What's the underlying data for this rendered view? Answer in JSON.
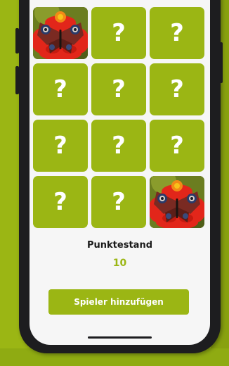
{
  "game": {
    "cards": [
      {
        "state": "revealed",
        "icon": "butterfly-on-flower-icon"
      },
      {
        "state": "hidden",
        "label": "?"
      },
      {
        "state": "hidden",
        "label": "?"
      },
      {
        "state": "hidden",
        "label": "?"
      },
      {
        "state": "hidden",
        "label": "?"
      },
      {
        "state": "hidden",
        "label": "?"
      },
      {
        "state": "hidden",
        "label": "?"
      },
      {
        "state": "hidden",
        "label": "?"
      },
      {
        "state": "hidden",
        "label": "?"
      },
      {
        "state": "hidden",
        "label": "?"
      },
      {
        "state": "hidden",
        "label": "?"
      },
      {
        "state": "revealed",
        "icon": "butterfly-on-flower-icon"
      }
    ]
  },
  "score": {
    "label": "Punktestand",
    "value": "10"
  },
  "actions": {
    "add_player_label": "Spieler hinzufügen"
  },
  "colors": {
    "accent": "#9bb614",
    "text": "#1a1a1a",
    "phone_frame": "#1d1d1f",
    "screen_bg": "#f6f6f6"
  }
}
